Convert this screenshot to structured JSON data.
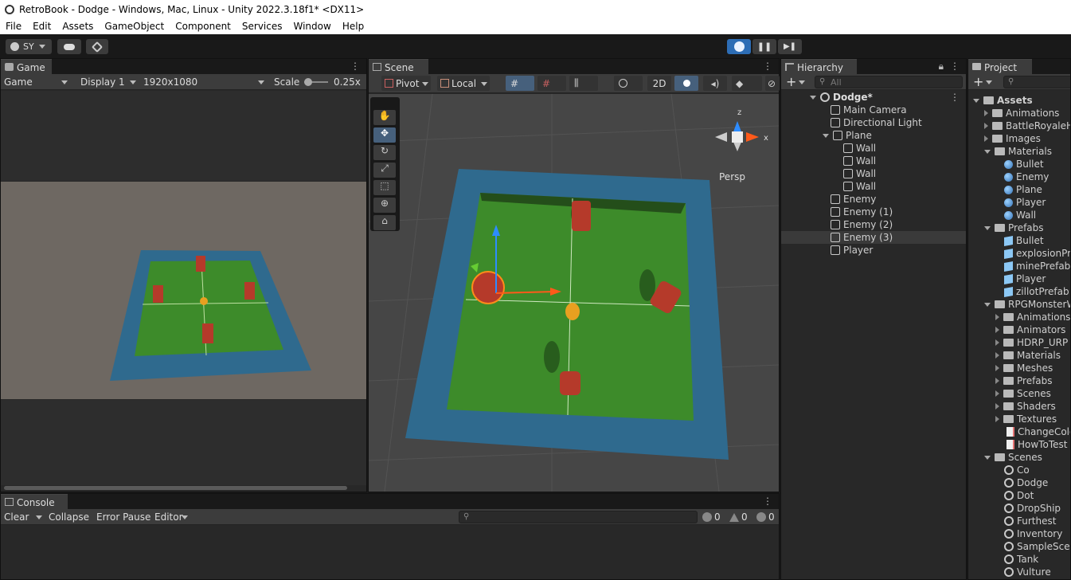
{
  "window": {
    "title": "RetroBook - Dodge - Windows, Mac, Linux - Unity 2022.3.18f1* <DX11>"
  },
  "menu": [
    "File",
    "Edit",
    "Assets",
    "GameObject",
    "Component",
    "Services",
    "Window",
    "Help"
  ],
  "toolbar": {
    "account": "SY"
  },
  "game": {
    "tab": "Game",
    "view_mode": "Game",
    "display": "Display 1",
    "resolution": "1920x1080",
    "scale_label": "Scale",
    "scale_value": "0.25x"
  },
  "scene": {
    "tab": "Scene",
    "pivot": "Pivot",
    "local": "Local",
    "mode_2d": "2D",
    "persp": "Persp",
    "gizmo_z": "z",
    "gizmo_x": "x"
  },
  "hierarchy": {
    "tab": "Hierarchy",
    "search_placeholder": "All",
    "scene_name": "Dodge*",
    "items": [
      {
        "label": "Main Camera"
      },
      {
        "label": "Directional Light"
      },
      {
        "label": "Plane"
      },
      {
        "label": "Wall"
      },
      {
        "label": "Wall"
      },
      {
        "label": "Wall"
      },
      {
        "label": "Wall"
      },
      {
        "label": "Enemy"
      },
      {
        "label": "Enemy (1)"
      },
      {
        "label": "Enemy (2)"
      },
      {
        "label": "Enemy (3)"
      },
      {
        "label": "Player"
      }
    ]
  },
  "project": {
    "tab": "Project",
    "items": [
      {
        "label": "Assets"
      },
      {
        "label": "Animations"
      },
      {
        "label": "BattleRoyaleH"
      },
      {
        "label": "Images"
      },
      {
        "label": "Materials"
      },
      {
        "label": "Bullet"
      },
      {
        "label": "Enemy"
      },
      {
        "label": "Plane"
      },
      {
        "label": "Player"
      },
      {
        "label": "Wall"
      },
      {
        "label": "Prefabs"
      },
      {
        "label": "Bullet"
      },
      {
        "label": "explosionPre"
      },
      {
        "label": "minePrefab"
      },
      {
        "label": "Player"
      },
      {
        "label": "zillotPrefab"
      },
      {
        "label": "RPGMonsterW"
      },
      {
        "label": "Animations"
      },
      {
        "label": "Animators"
      },
      {
        "label": "HDRP_URP"
      },
      {
        "label": "Materials"
      },
      {
        "label": "Meshes"
      },
      {
        "label": "Prefabs"
      },
      {
        "label": "Scenes"
      },
      {
        "label": "Shaders"
      },
      {
        "label": "Textures"
      },
      {
        "label": "ChangeColo"
      },
      {
        "label": "HowToTest"
      },
      {
        "label": "Scenes"
      },
      {
        "label": "Co"
      },
      {
        "label": "Dodge"
      },
      {
        "label": "Dot"
      },
      {
        "label": "DropShip"
      },
      {
        "label": "Furthest"
      },
      {
        "label": "Inventory"
      },
      {
        "label": "SampleScer"
      },
      {
        "label": "Tank"
      },
      {
        "label": "Vulture"
      }
    ]
  },
  "console": {
    "tab": "Console",
    "clear": "Clear",
    "collapse": "Collapse",
    "error_pause": "Error Pause",
    "editor": "Editor",
    "log_count": "0",
    "warn_count": "0",
    "error_count": "0"
  },
  "colors": {
    "play_accent": "#2d6db5",
    "wall": "#2f6a8e",
    "floor": "#3d8b2a",
    "enemy": "#b53a2a",
    "player": "#e8a020"
  }
}
